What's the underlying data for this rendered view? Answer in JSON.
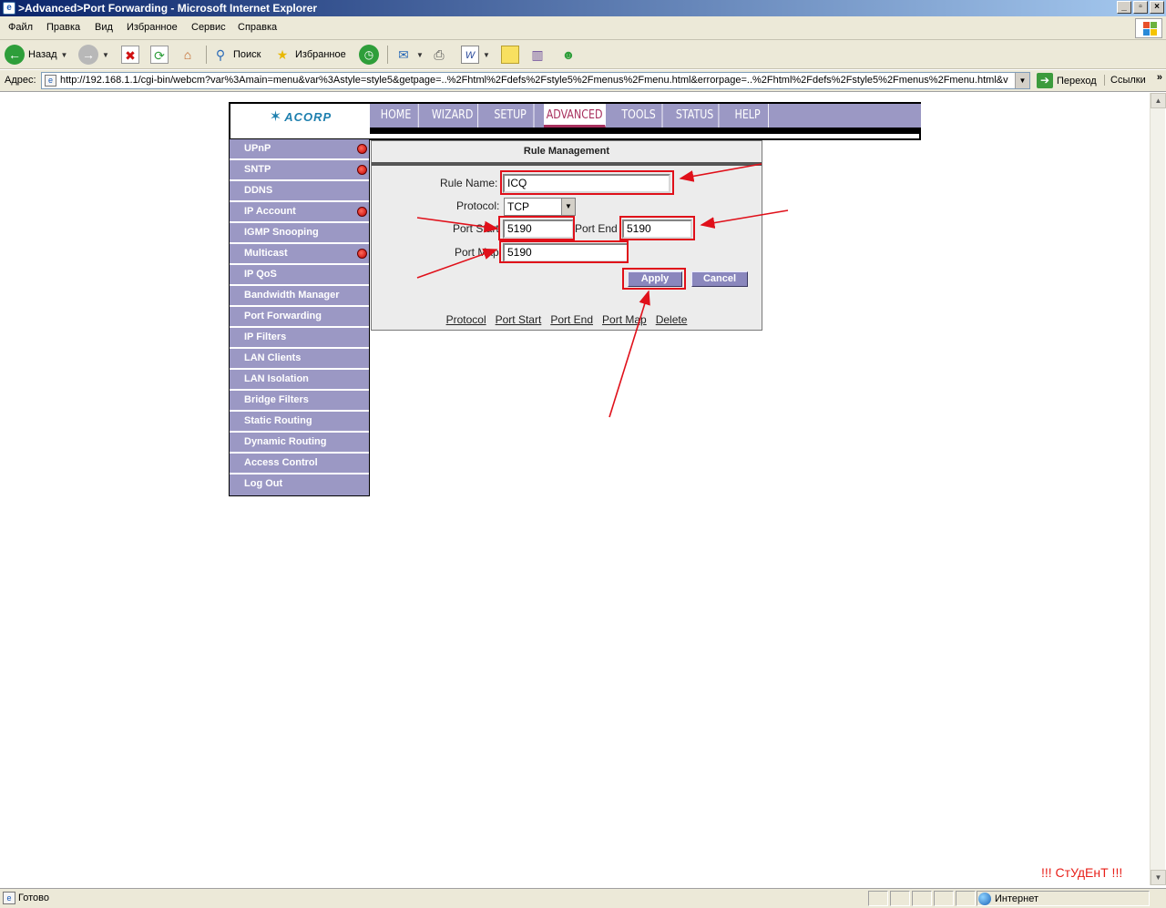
{
  "window": {
    "title": ">Advanced>Port Forwarding - Microsoft Internet Explorer",
    "min_btn": "_",
    "max_btn": "▫",
    "close_btn": "×"
  },
  "menubar": [
    "Файл",
    "Правка",
    "Вид",
    "Избранное",
    "Сервис",
    "Справка"
  ],
  "toolbar": {
    "back": "Назад",
    "search": "Поиск",
    "favorites": "Избранное"
  },
  "address": {
    "label": "Адрес:",
    "url": "http://192.168.1.1/cgi-bin/webcm?var%3Amain=menu&var%3Astyle=style5&getpage=..%2Fhtml%2Fdefs%2Fstyle5%2Fmenus%2Fmenu.html&errorpage=..%2Fhtml%2Fdefs%2Fstyle5%2Fmenus%2Fmenu.html&v",
    "go": "Переход",
    "links": "Ссылки"
  },
  "status": {
    "text": "Готово",
    "zone": "Интернет"
  },
  "router": {
    "logo": "ACORP",
    "nav": [
      "HOME",
      "WIZARD",
      "SETUP",
      "ADVANCED",
      "TOOLS",
      "STATUS",
      "HELP"
    ],
    "nav_active": "ADVANCED",
    "sidebar": [
      {
        "label": "UPnP",
        "led": true
      },
      {
        "label": "SNTP",
        "led": true
      },
      {
        "label": "DDNS",
        "led": false
      },
      {
        "label": "IP Account",
        "led": true
      },
      {
        "label": "IGMP Snooping",
        "led": false
      },
      {
        "label": "Multicast",
        "led": true
      },
      {
        "label": "IP QoS",
        "led": false
      },
      {
        "label": "Bandwidth Manager",
        "led": false
      },
      {
        "label": "Port Forwarding",
        "led": false
      },
      {
        "label": "IP Filters",
        "led": false
      },
      {
        "label": "LAN Clients",
        "led": false
      },
      {
        "label": "LAN Isolation",
        "led": false
      },
      {
        "label": "Bridge Filters",
        "led": false
      },
      {
        "label": "Static Routing",
        "led": false
      },
      {
        "label": "Dynamic Routing",
        "led": false
      },
      {
        "label": "Access Control",
        "led": false
      },
      {
        "label": "Log Out",
        "led": false
      }
    ],
    "form": {
      "title": "Rule Management",
      "rule_name_label": "Rule Name:",
      "rule_name_value": "ICQ",
      "protocol_label": "Protocol:",
      "protocol_value": "TCP",
      "port_start_label": "Port Start",
      "port_start_value": "5190",
      "port_end_label": "Port End",
      "port_end_value": "5190",
      "port_map_label": "Port Map",
      "port_map_value": "5190",
      "apply": "Apply",
      "cancel": "Cancel",
      "table_headers": [
        "Protocol",
        "Port Start",
        "Port End",
        "Port Map",
        "Delete"
      ]
    }
  },
  "watermark": "!!! СтУдЕнТ !!!",
  "colors": {
    "nav_bg": "#9b98c4",
    "active_tab": "#a8305e",
    "highlight": "#e0101a",
    "titlebar": "#0a246a"
  }
}
